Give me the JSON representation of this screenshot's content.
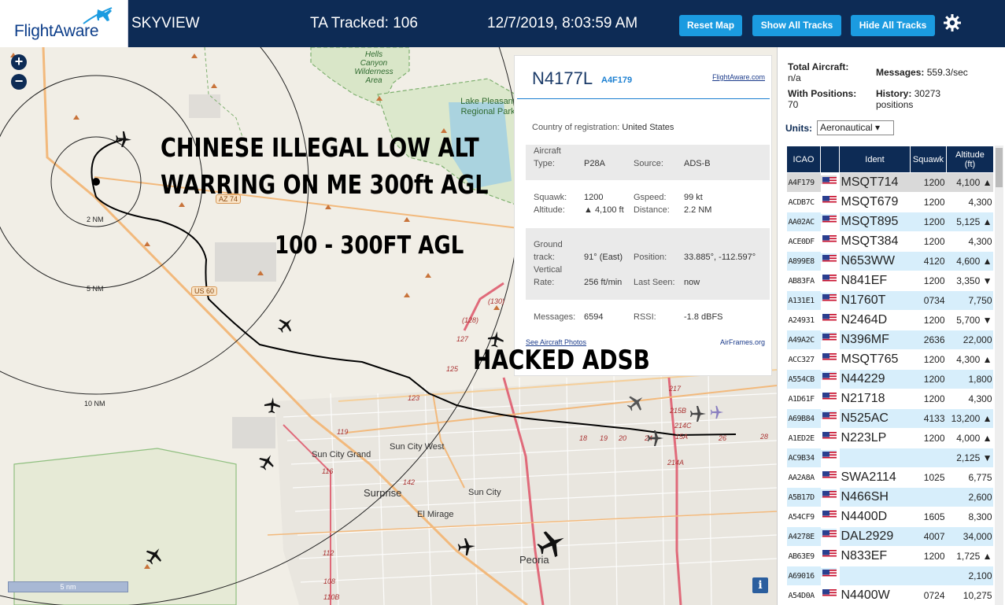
{
  "header": {
    "logo_text": "FlightAware",
    "site_name": "SKYVIEW",
    "tracked_label": "TA Tracked: 106",
    "datetime": "12/7/2019, 8:03:59 AM",
    "buttons": {
      "reset_map": "Reset Map",
      "show_all_tracks": "Show All Tracks",
      "hide_all_tracks": "Hide All Tracks"
    },
    "colors": {
      "background": "#0d2b55",
      "button": "#1b9be0"
    }
  },
  "map": {
    "zoom_in": "+",
    "zoom_out": "−",
    "scale_bar": "5 nm",
    "info_button": "i",
    "range_rings": [
      "2 NM",
      "5 NM",
      "10 NM"
    ],
    "place_labels": [
      "Hells Canyon Wilderness Area",
      "Lake Pleasant Regional Park",
      "Sun City Grand",
      "Sun City West",
      "Surprise",
      "Sun City",
      "El Mirage",
      "Peoria"
    ],
    "road_labels": [
      "AZ 74",
      "US 60",
      "(130)",
      "(128)",
      "127",
      "125",
      "123",
      "119",
      "116",
      "112",
      "108",
      "110B",
      "142",
      "217",
      "215B",
      "214C",
      "214A",
      "15A",
      "18",
      "19",
      "20",
      "24",
      "26",
      "28"
    ],
    "overlay_text": {
      "line1": "CHINESE ILLEGAL LOW ALT",
      "line2": "WARRING ON ME 300ft AGL",
      "line3": "100 - 300FT AGL",
      "line4": "HACKED ADSB"
    }
  },
  "selected_aircraft": {
    "callsign": "N4177L",
    "icao": "A4F179",
    "flightaware_link": "FlightAware.com",
    "country_label": "Country of registration:",
    "country": "United States",
    "aircraft_type_label": "Aircraft Type:",
    "aircraft_type_label_1": "Aircraft",
    "aircraft_type_label_2": "Type:",
    "aircraft_type": "P28A",
    "source_label": "Source:",
    "source": "ADS-B",
    "squawk_label": "Squawk:",
    "squawk": "1200",
    "gspeed_label": "Gspeed:",
    "gspeed": "99 kt",
    "altitude_label": "Altitude:",
    "altitude": "▲ 4,100 ft",
    "distance_label": "Distance:",
    "distance": "2.2 NM",
    "ground_track_label_1": "Ground",
    "ground_track_label_2": "track:",
    "ground_track": "91° (East)",
    "position_label": "Position:",
    "position": "33.885°, -112.597°",
    "vertical_rate_label_1": "Vertical",
    "vertical_rate_label_2": "Rate:",
    "vertical_rate": "256 ft/min",
    "last_seen_label": "Last Seen:",
    "last_seen": "now",
    "messages_label": "Messages:",
    "messages": "6594",
    "rssi_label": "RSSI:",
    "rssi": "-1.8 dBFS",
    "photos_link": "See Aircraft Photos",
    "airframes_link": "AirFrames.org"
  },
  "sidebar": {
    "total_aircraft_label": "Total Aircraft:",
    "total_aircraft": "n/a",
    "messages_label": "Messages:",
    "messages": "559.3/sec",
    "with_positions_label": "With Positions:",
    "with_positions": "70",
    "history_label": "History:",
    "history": "30273",
    "history_unit": "positions",
    "units_label": "Units:",
    "units_value": "Aeronautical ▾",
    "table": {
      "headers": {
        "icao": "ICAO",
        "flag": "",
        "ident": "Ident",
        "squawk": "Squawk",
        "altitude": "Altitude (ft)",
        "altitude_1": "Altitude",
        "altitude_2": "(ft)"
      },
      "rows": [
        {
          "icao": "A4F179",
          "ident": "MSQT714",
          "squawk": "1200",
          "alt": "4,100 ▲"
        },
        {
          "icao": "ACDB7C",
          "ident": "MSQT679",
          "squawk": "1200",
          "alt": "4,300"
        },
        {
          "icao": "AA02AC",
          "ident": "MSQT895",
          "squawk": "1200",
          "alt": "5,125 ▲"
        },
        {
          "icao": "ACE0DF",
          "ident": "MSQT384",
          "squawk": "1200",
          "alt": "4,300"
        },
        {
          "icao": "A899E8",
          "ident": "N653WW",
          "squawk": "4120",
          "alt": "4,600 ▲"
        },
        {
          "icao": "AB83FA",
          "ident": "N841EF",
          "squawk": "1200",
          "alt": "3,350 ▼"
        },
        {
          "icao": "A131E1",
          "ident": "N1760T",
          "squawk": "0734",
          "alt": "7,750"
        },
        {
          "icao": "A24931",
          "ident": "N2464D",
          "squawk": "1200",
          "alt": "5,700 ▼"
        },
        {
          "icao": "A49A2C",
          "ident": "N396MF",
          "squawk": "2636",
          "alt": "22,000"
        },
        {
          "icao": "ACC327",
          "ident": "MSQT765",
          "squawk": "1200",
          "alt": "4,300 ▲"
        },
        {
          "icao": "A554CB",
          "ident": "N44229",
          "squawk": "1200",
          "alt": "1,800"
        },
        {
          "icao": "A1D61F",
          "ident": "N21718",
          "squawk": "1200",
          "alt": "4,300"
        },
        {
          "icao": "A69B84",
          "ident": "N525AC",
          "squawk": "4133",
          "alt": "13,200 ▲"
        },
        {
          "icao": "A1ED2E",
          "ident": "N223LP",
          "squawk": "1200",
          "alt": "4,000 ▲"
        },
        {
          "icao": "AC9B34",
          "ident": "",
          "squawk": "",
          "alt": "2,125 ▼"
        },
        {
          "icao": "AA2A8A",
          "ident": "SWA2114",
          "squawk": "1025",
          "alt": "6,775"
        },
        {
          "icao": "A5B17D",
          "ident": "N466SH",
          "squawk": "",
          "alt": "2,600"
        },
        {
          "icao": "A54CF9",
          "ident": "N4400D",
          "squawk": "1605",
          "alt": "8,300"
        },
        {
          "icao": "A4278E",
          "ident": "DAL2929",
          "squawk": "4007",
          "alt": "34,000"
        },
        {
          "icao": "AB63E9",
          "ident": "N833EF",
          "squawk": "1200",
          "alt": "1,725 ▲"
        },
        {
          "icao": "A69016",
          "ident": "",
          "squawk": "",
          "alt": "2,100"
        },
        {
          "icao": "A54D0A",
          "ident": "N4400W",
          "squawk": "0724",
          "alt": "10,275"
        }
      ]
    }
  }
}
